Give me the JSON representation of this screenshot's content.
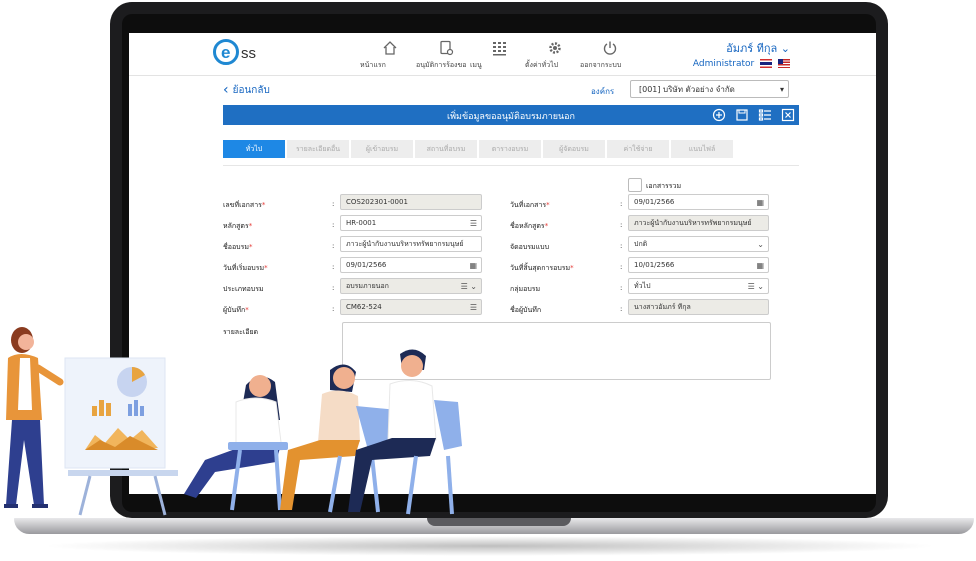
{
  "header": {
    "nav": [
      {
        "label": "หน้าแรก",
        "icon": "home-icon"
      },
      {
        "label": "อนุมัติการร้องขอ",
        "icon": "approve-document-icon"
      },
      {
        "label": "เมนู",
        "icon": "grid-menu-icon"
      },
      {
        "label": "ตั้งค่าทั่วไป",
        "icon": "gear-icon"
      },
      {
        "label": "ออกจากระบบ",
        "icon": "power-icon"
      }
    ],
    "user_name": "อัมภร์ ทีกุล",
    "user_role": "Administrator"
  },
  "toolbar": {
    "back_label": "ย้อนกลับ",
    "org_label": "องค์กร",
    "org_value": "[001] บริษัท ตัวอย่าง จำกัด"
  },
  "title": "เพิ่มข้อมูลขออนุมัติอบรมภายนอก",
  "tabs": [
    "ทั่วไป",
    "รายละเอียดอื่น",
    "ผู้เข้าอบรม",
    "สถานที่อบรม",
    "ตารางอบรม",
    "ผู้จัดอบรม",
    "ค่าใช้จ่าย",
    "แนบไฟล์"
  ],
  "form": {
    "group_doc_label": "เอกสารรวม",
    "doc_no_label": "เลขที่เอกสาร",
    "doc_no": "COS202301-0001",
    "doc_date_label": "วันที่เอกสาร",
    "doc_date": "09/01/2566",
    "course_label": "หลักสูตร",
    "course": "HR-0001",
    "course_name_label": "ชื่อหลักสูตร",
    "course_name": "ภาวะผู้นำกับงานบริหารทรัพยากรมนุษย์",
    "training_name_label": "ชื่ออบรม",
    "training_name": "ภาวะผู้นำกับงานบริหารทรัพยากรมนุษย์",
    "format_label": "จัดอบรมแบบ",
    "format": "ปกติ",
    "start_label": "วันที่เริ่มอบรม",
    "start": "09/01/2566",
    "end_label": "วันที่สิ้นสุดการอบรม",
    "end": "10/01/2566",
    "type_label": "ประเภทอบรม",
    "type": "อบรมภายนอก",
    "group_label": "กลุ่มอบรม",
    "group": "ทั่วไป",
    "recorder_label": "ผู้บันทึก",
    "recorder": "CM62-524",
    "recorder_name_label": "ชื่อผู้บันทึก",
    "recorder_name": "นางสาวอัมภร์ ทีกุล",
    "detail_label": "รายละเอียด"
  }
}
